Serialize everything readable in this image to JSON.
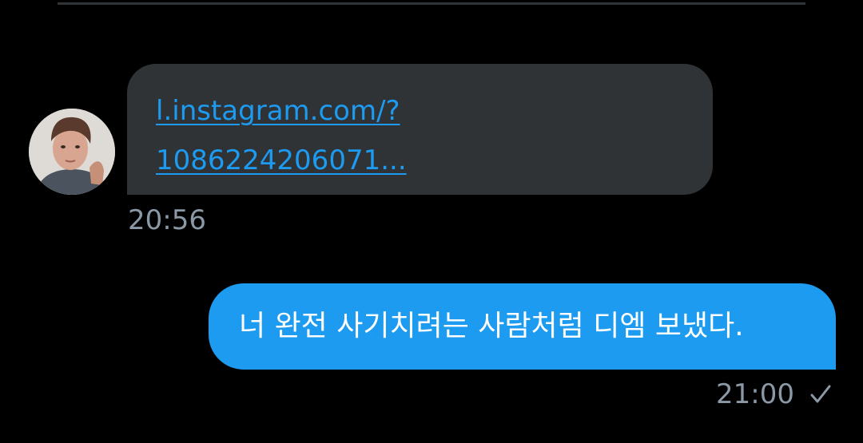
{
  "conversation": {
    "received_message": {
      "link_line_1": "l.instagram.com/?",
      "link_line_2": "1086224206071...",
      "time": "20:56"
    },
    "sent_message": {
      "text": "너 완전 사기치려는 사람처럼 디엠 보냈다.",
      "time": "21:00",
      "status_icon": "checkmark-icon"
    }
  },
  "colors": {
    "background": "#000000",
    "received_bubble": "#2f3336",
    "sent_bubble": "#1d9bf0",
    "link": "#1d9bf0",
    "timestamp": "#8b98a5"
  }
}
